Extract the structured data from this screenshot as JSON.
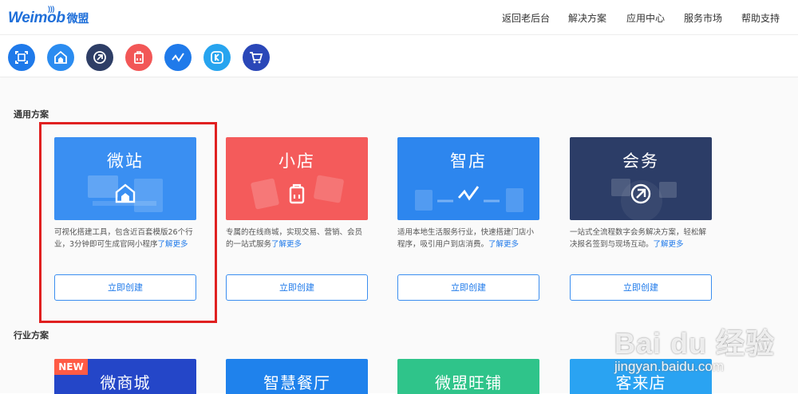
{
  "header": {
    "logo_text": "Weimob",
    "logo_cn": "微盟",
    "nav": [
      "返回老后台",
      "解决方案",
      "应用中心",
      "服务市场",
      "帮助支持"
    ]
  },
  "app_icons": [
    {
      "icon": "frame-icon",
      "color": "#1f7aea"
    },
    {
      "icon": "home-store-icon",
      "color": "#2b8cf0"
    },
    {
      "icon": "swap-circle-icon",
      "color": "#2e3e66"
    },
    {
      "icon": "shop-bag-icon",
      "color": "#f25757"
    },
    {
      "icon": "zigzag-icon",
      "color": "#1f7aea"
    },
    {
      "icon": "k-badge-icon",
      "color": "#27a4ef"
    },
    {
      "icon": "cart-icon",
      "color": "#2a47b8"
    }
  ],
  "general": {
    "title": "通用方案",
    "cards": [
      {
        "title": "微站",
        "color": "#3a8ff2",
        "desc": "可视化搭建工具，包含近百套模版26个行业，3分钟即可生成官网小程序",
        "more": "了解更多",
        "button": "立即创建"
      },
      {
        "title": "小店",
        "color": "#f45b5b",
        "desc": "专属的在线商城，实现交易、营销、会员的一站式服务",
        "more": "了解更多",
        "button": "立即创建"
      },
      {
        "title": "智店",
        "color": "#2d86ee",
        "desc": "适用本地生活服务行业，快速搭建门店小程序，吸引用户到店消费。",
        "more": "了解更多",
        "button": "立即创建"
      },
      {
        "title": "会务",
        "color": "#2c3d67",
        "desc": "一站式全流程数字会务解决方案，轻松解决报名签到与现场互动。",
        "more": "了解更多",
        "button": "立即创建"
      }
    ]
  },
  "industry": {
    "title": "行业方案",
    "new_tag": "NEW",
    "cards": [
      {
        "title": "微商城",
        "color": "#2446c8"
      },
      {
        "title": "智慧餐厅",
        "color": "#1f82ec"
      },
      {
        "title": "微盟旺铺",
        "color": "#2fc48a"
      },
      {
        "title": "客来店",
        "color": "#2aa3f2"
      }
    ]
  },
  "watermark": {
    "brand": "Bai du 经验",
    "url": "jingyan.baidu.com"
  }
}
